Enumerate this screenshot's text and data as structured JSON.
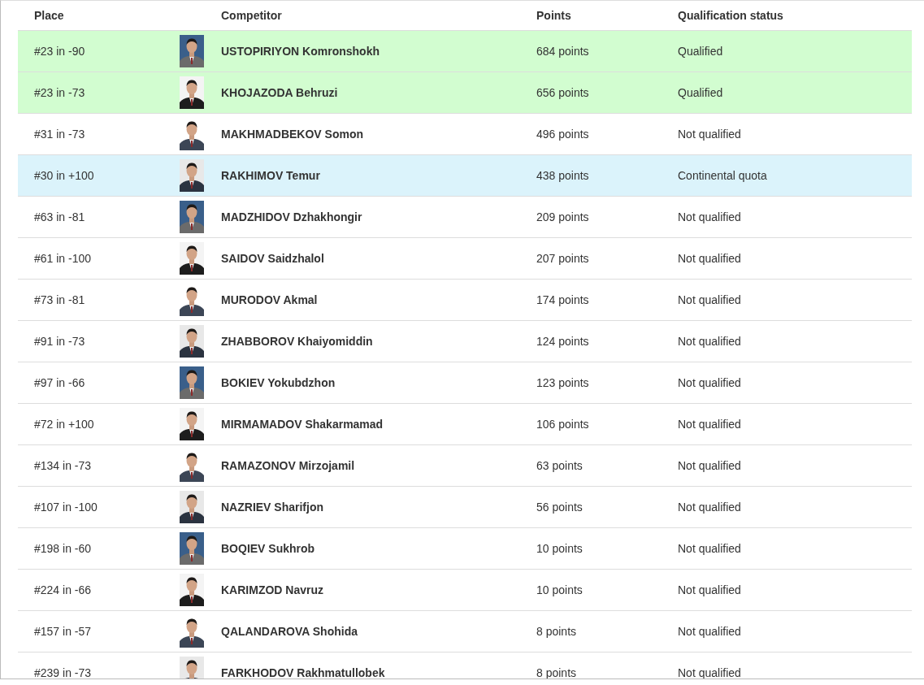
{
  "table": {
    "columns": [
      "Place",
      "Competitor",
      "Points",
      "Qualification status"
    ],
    "rows": [
      {
        "place": "#23 in -90",
        "competitor": "USTOPIRIYON Komronshokh",
        "points": "684 points",
        "status": "Qualified",
        "kind": "qualified"
      },
      {
        "place": "#23 in -73",
        "competitor": "KHOJAZODA Behruzi",
        "points": "656 points",
        "status": "Qualified",
        "kind": "qualified"
      },
      {
        "place": "#31 in -73",
        "competitor": "MAKHMADBEKOV Somon",
        "points": "496 points",
        "status": "Not qualified",
        "kind": "not"
      },
      {
        "place": "#30 in +100",
        "competitor": "RAKHIMOV Temur",
        "points": "438 points",
        "status": "Continental quota",
        "kind": "continental"
      },
      {
        "place": "#63 in -81",
        "competitor": "MADZHIDOV Dzhakhongir",
        "points": "209 points",
        "status": "Not qualified",
        "kind": "not"
      },
      {
        "place": "#61 in -100",
        "competitor": "SAIDOV Saidzhalol",
        "points": "207 points",
        "status": "Not qualified",
        "kind": "not"
      },
      {
        "place": "#73 in -81",
        "competitor": "MURODOV Akmal",
        "points": "174 points",
        "status": "Not qualified",
        "kind": "not"
      },
      {
        "place": "#91 in -73",
        "competitor": "ZHABBOROV Khaiyomiddin",
        "points": "124 points",
        "status": "Not qualified",
        "kind": "not"
      },
      {
        "place": "#97 in -66",
        "competitor": "BOKIEV Yokubdzhon",
        "points": "123 points",
        "status": "Not qualified",
        "kind": "not"
      },
      {
        "place": "#72 in +100",
        "competitor": "MIRMAMADOV Shakarmamad",
        "points": "106 points",
        "status": "Not qualified",
        "kind": "not"
      },
      {
        "place": "#134 in -73",
        "competitor": "RAMAZONOV Mirzojamil",
        "points": "63 points",
        "status": "Not qualified",
        "kind": "not"
      },
      {
        "place": "#107 in -100",
        "competitor": "NAZRIEV Sharifjon",
        "points": "56 points",
        "status": "Not qualified",
        "kind": "not"
      },
      {
        "place": "#198 in -60",
        "competitor": "BOQIEV Sukhrob",
        "points": "10 points",
        "status": "Not qualified",
        "kind": "not"
      },
      {
        "place": "#224 in -66",
        "competitor": "KARIMZOD Navruz",
        "points": "10 points",
        "status": "Not qualified",
        "kind": "not"
      },
      {
        "place": "#157 in -57",
        "competitor": "QALANDAROVA Shohida",
        "points": "8 points",
        "status": "Not qualified",
        "kind": "not"
      },
      {
        "place": "#239 in -73",
        "competitor": "FARKHODOV Rakhmatullobek",
        "points": "8 points",
        "status": "Not qualified",
        "kind": "not"
      }
    ]
  }
}
